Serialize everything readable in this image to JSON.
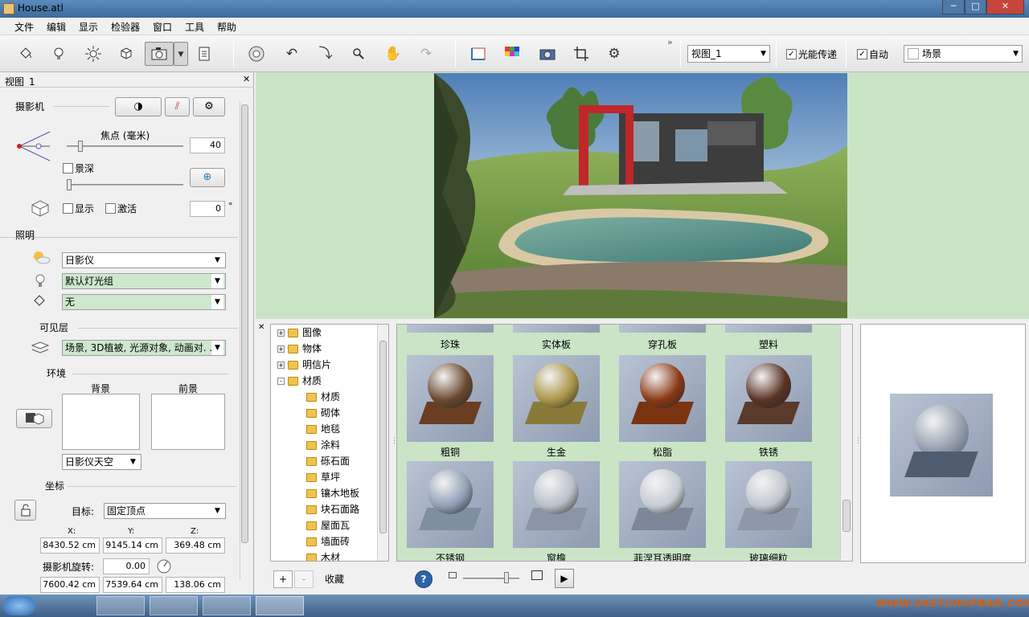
{
  "window": {
    "title": "House.atl",
    "minimize": "─",
    "maximize": "□",
    "close": "✕"
  },
  "menu": [
    "文件",
    "编辑",
    "显示",
    "检验器",
    "窗口",
    "工具",
    "帮助"
  ],
  "toolbar": {
    "view_combo": "视图_1",
    "gi_checked": true,
    "gi_label": "光能传递",
    "auto_checked": true,
    "auto_label": "自动",
    "scene_combo": "场景",
    "overflow": "»"
  },
  "left": {
    "tab_title": "视图_1",
    "close": "✕",
    "camera_header": "摄影机",
    "focal_label": "焦点 (毫米)",
    "focal_value": "40",
    "dof_label": "景深",
    "show_label": "显示",
    "activate_label": "激活",
    "angle_value": "0",
    "degree": "°",
    "lighting_header": "照明",
    "sun_combo": "日影仪",
    "light_group_combo": "默认灯光组",
    "light_none_combo": "无",
    "visible_layers_header": "可见层",
    "layers_combo": "场景, 3D植被, 光源对象, 动画对. . .",
    "environment_header": "环境",
    "background_label": "背景",
    "foreground_label": "前景",
    "sky_combo": "日影仪天空",
    "coords_header": "坐标",
    "target_label": "目标:",
    "target_combo": "固定顶点",
    "x_label": "X:",
    "y_label": "Y:",
    "z_label": "Z:",
    "x_value": "8430.52 cm",
    "y_value": "9145.14 cm",
    "z_value": "369.48 cm",
    "rotation_label": "摄影机旋转:",
    "rotation_value": "0.00",
    "x2_value": "7600.42 cm",
    "y2_value": "7539.64 cm",
    "z2_value": "138.06 cm"
  },
  "tree": {
    "items": [
      {
        "label": "图像",
        "level": 0,
        "expander": "+"
      },
      {
        "label": "物体",
        "level": 0,
        "expander": "+"
      },
      {
        "label": "明信片",
        "level": 0,
        "expander": "+"
      },
      {
        "label": "材质",
        "level": 0,
        "expander": "-"
      },
      {
        "label": "材质",
        "level": 1
      },
      {
        "label": "砌体",
        "level": 1
      },
      {
        "label": "地毯",
        "level": 1
      },
      {
        "label": "涂料",
        "level": 1
      },
      {
        "label": "砾石面",
        "level": 1
      },
      {
        "label": "草坪",
        "level": 1
      },
      {
        "label": "镶木地板",
        "level": 1
      },
      {
        "label": "块石面路",
        "level": 1
      },
      {
        "label": "屋面瓦",
        "level": 1
      },
      {
        "label": "墙面砖",
        "level": 1
      },
      {
        "label": "木材",
        "level": 1
      }
    ],
    "add": "+",
    "remove": "-",
    "favorites": "收藏"
  },
  "gallery": {
    "top_labels": [
      "珍珠",
      "实体板",
      "穿孔板",
      "塑料"
    ],
    "row1": [
      {
        "label": "粗铜",
        "ball": "#6b4a30",
        "base": "#6a3e22"
      },
      {
        "label": "生金",
        "ball": "#a99648",
        "base": "#8a7a3a"
      },
      {
        "label": "松脂",
        "ball": "#8a3a16",
        "base": "#7a3412"
      },
      {
        "label": "铁锈",
        "ball": "#5a3426",
        "base": "#5a3a2a"
      }
    ],
    "row2": [
      {
        "label": "不锈钢",
        "ball": "#8f9fb4",
        "base": "#7f8fa2"
      },
      {
        "label": "窗檐",
        "ball": "#b9c0c8",
        "base": "#8a96a6"
      },
      {
        "label": "菲涅耳透明度",
        "ball": "#c6ccd4",
        "base": "#7c8898"
      },
      {
        "label": "玻璃细粒",
        "ball": "#c0c6ce",
        "base": "#8e98a8"
      }
    ]
  },
  "bottom_bar": {
    "help": "?",
    "play": "▶"
  },
  "watermark": "WWW.SKETCHUPBAR.COM"
}
